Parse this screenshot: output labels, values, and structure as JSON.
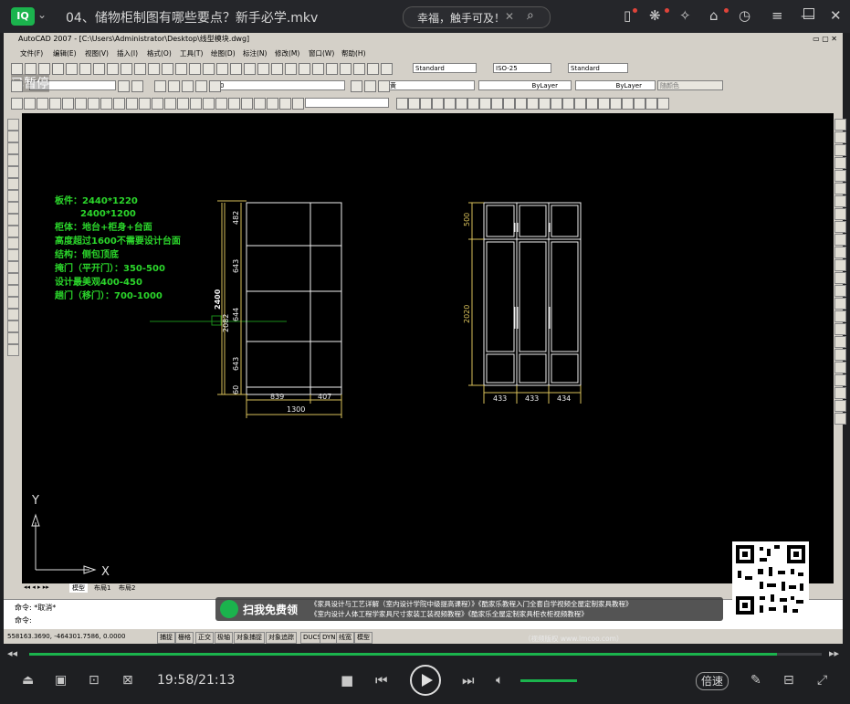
{
  "player": {
    "title": "04、储物柜制图有哪些要点？新手必学.mkv",
    "search_text": "幸福，触手可及！",
    "time": "19:58/21:13",
    "speed_label": "倍速",
    "paused_label": "已暂停",
    "progress": 0.943,
    "volume": 0.6,
    "accent": "#1bb34d"
  },
  "cad": {
    "window_title": "AutoCAD 2007 - [C:\\Users\\Administrator\\Desktop\\线型模块.dwg]",
    "menus": [
      "文件(F)",
      "编辑(E)",
      "视图(V)",
      "插入(I)",
      "格式(O)",
      "工具(T)",
      "绘图(D)",
      "标注(N)",
      "修改(M)",
      "窗口(W)",
      "帮助(H)"
    ],
    "text_style": "Standard",
    "dim_style": "ISO-25",
    "table_style": "Standard",
    "layer_value": "0",
    "color_value": "黄",
    "linetype": "ByLayer",
    "lineweight": "ByLayer",
    "plotstyle": "随颜色",
    "tabs": [
      "模型",
      "布局1",
      "布局2"
    ],
    "command_lines": [
      "命令: *取消*",
      "命令:"
    ],
    "coords": "558163.3690, -464301.7586, 0.0000",
    "status_buttons": [
      "捕捉",
      "栅格",
      "正交",
      "极轴",
      "对象捕捉",
      "对象追踪",
      "DUCS",
      "DYN",
      "线宽",
      "模型"
    ],
    "notes": [
      "板件：2440*1220",
      "2400*1200",
      "柜体：地台+柜身+台面",
      "高度超过1600不需要设计台面",
      "结构：侧包顶底",
      "掩门（平开门）：350-500",
      "设计最美观400-450",
      "趟门（移门）：700-1000"
    ],
    "left_dims": [
      "482",
      "643",
      "644",
      "643",
      "60"
    ],
    "left_total": "2082",
    "left_side_label": "2400",
    "left_bottom": [
      "839",
      "407"
    ],
    "left_width": "1300",
    "right_dims": [
      "500",
      "2020"
    ],
    "right_bottom": [
      "433",
      "433",
      "434"
    ],
    "ucs_y": "Y",
    "ucs_x": "X"
  },
  "promo": {
    "head": "扫我免费领",
    "line1": "《家具设计与工艺详解（室内设计学院中级提高课程）》《酷家乐教程入门全套自学视频全屋定制家具教程》",
    "line2": "《室内设计人体工程学家具尺寸家装工装视频教程》《酷家乐全屋定制家具柜衣柜视频教程》",
    "url": "（视频版权 www.lmcoo.com）"
  }
}
